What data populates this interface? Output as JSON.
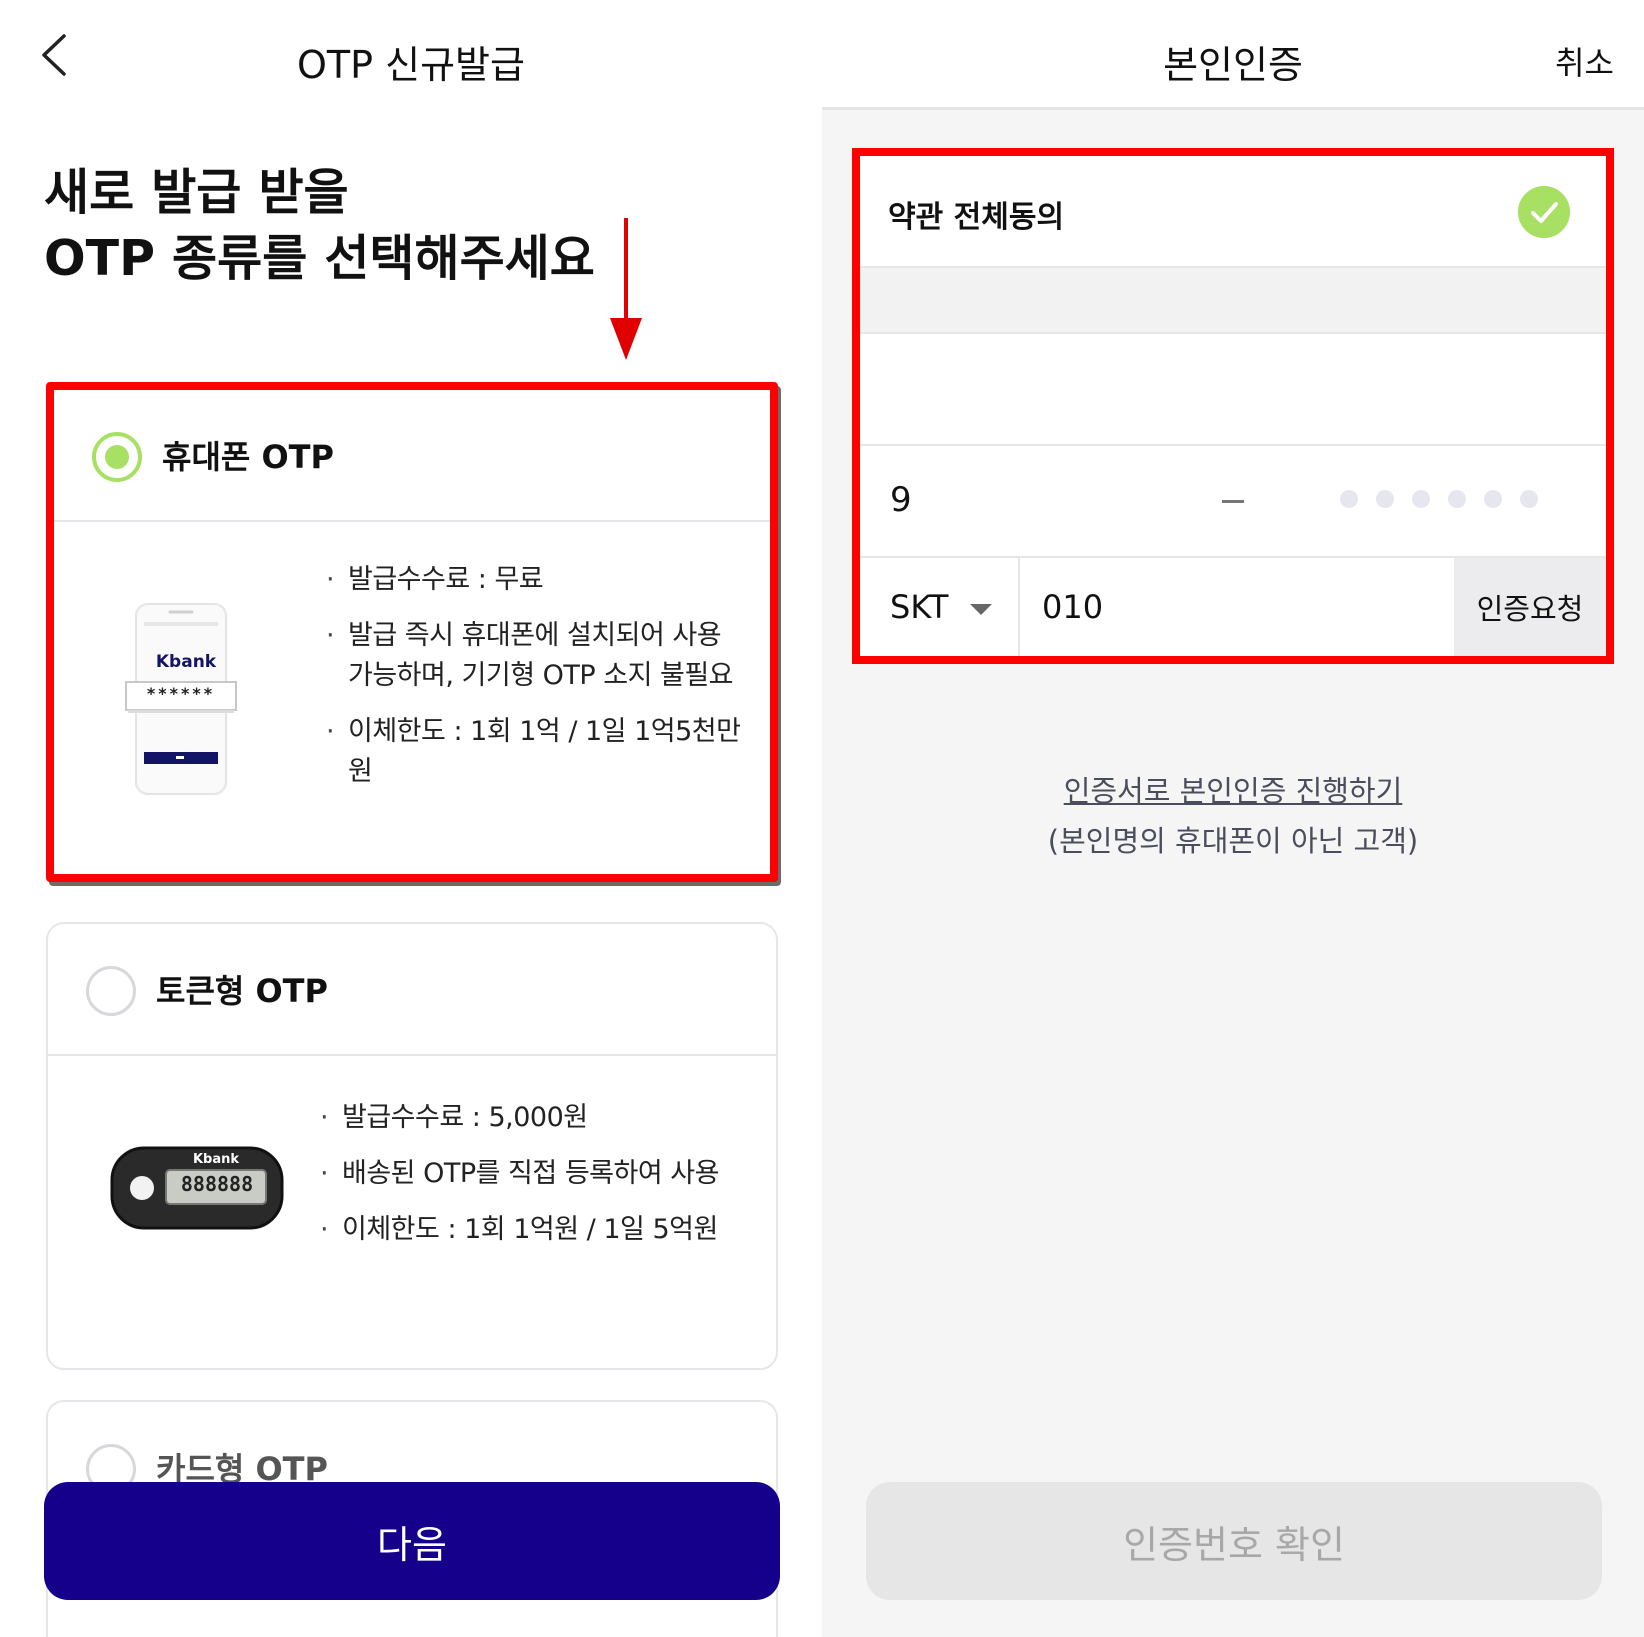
{
  "left": {
    "nav_title": "OTP 신규발급",
    "heading_line1": "새로 발급 받을",
    "heading_line2": "OTP 종류를 선택해주세요",
    "options": [
      {
        "title": "휴대폰 OTP",
        "selected": true,
        "brand": "Kbank",
        "masked": "******",
        "bullets": [
          "발급수수료 : 무료",
          "발급 즉시 휴대폰에 설치되어 사용 가능하며, 기기형 OTP 소지 불필요",
          "이체한도 : 1회 1억 / 1일 1억5천만원"
        ]
      },
      {
        "title": "토큰형 OTP",
        "selected": false,
        "brand": "Kbank",
        "display": "888888",
        "bullets": [
          "발급수수료 : 5,000원",
          "배송된 OTP를 직접 등록하여 사용",
          "이체한도 : 1회 1억원 / 1일 5억원"
        ]
      },
      {
        "title": "카드형 OTP",
        "selected": false
      }
    ],
    "next_label": "다음"
  },
  "right": {
    "nav_title": "본인인증",
    "cancel_label": "취소",
    "agree_all_label": "약관 전체동의",
    "id_first_digit": "9",
    "carrier": "SKT",
    "phone_prefix": "010",
    "request_label": "인증요청",
    "cert_link": "인증서로 본인인증 진행하기",
    "cert_sub": "(본인명의 휴대폰이 아닌 고객)",
    "confirm_label": "인증번호 확인"
  },
  "colors": {
    "primary": "#14008a",
    "accent_green": "#a8e063",
    "highlight_red": "#ff0000"
  }
}
